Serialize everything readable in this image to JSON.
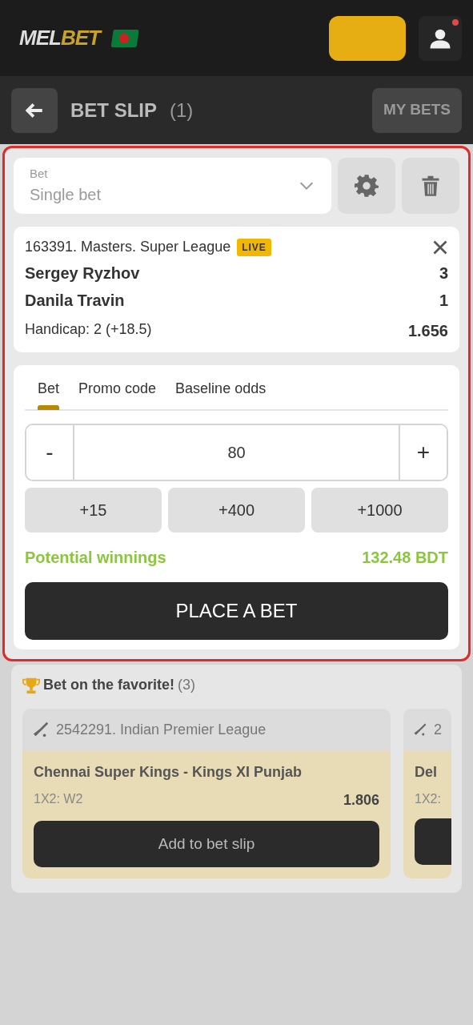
{
  "header": {
    "logo": {
      "text_1": "MEL",
      "text_2": "BET"
    },
    "notification": true
  },
  "bet_slip_bar": {
    "title": "BET SLIP",
    "count": "(1)",
    "my_bets": "MY BETS"
  },
  "bet_type": {
    "label": "Bet",
    "value": "Single bet"
  },
  "event": {
    "league": "163391. Masters. Super League",
    "live_badge": "LIVE",
    "players": [
      {
        "name": "Sergey Ryzhov",
        "score": "3"
      },
      {
        "name": "Danila Travin",
        "score": "1"
      }
    ],
    "market": "Handicap: 2 (+18.5)",
    "odds": "1.656"
  },
  "tabs": [
    {
      "label": "Bet",
      "selected": true
    },
    {
      "label": "Promo code",
      "selected": false
    },
    {
      "label": "Baseline odds",
      "selected": false
    }
  ],
  "stake": {
    "minus": "-",
    "value": "80",
    "plus": "+"
  },
  "quick_amounts": [
    "+15",
    "+400",
    "+1000"
  ],
  "potential_winnings": {
    "label": "Potential winnings",
    "value": "132.48 BDT"
  },
  "place_bet": "PLACE A BET",
  "favorites": {
    "title": "Bet on the favorite!",
    "count": "(3)",
    "cards": [
      {
        "league": "2542291. Indian Premier League",
        "match": "Chennai Super Kings - Kings XI Punjab",
        "market": "1X2: W2",
        "odds": "1.806",
        "button": "Add to bet slip"
      },
      {
        "league": "2",
        "match": "Del",
        "market": "1X2:"
      }
    ]
  }
}
